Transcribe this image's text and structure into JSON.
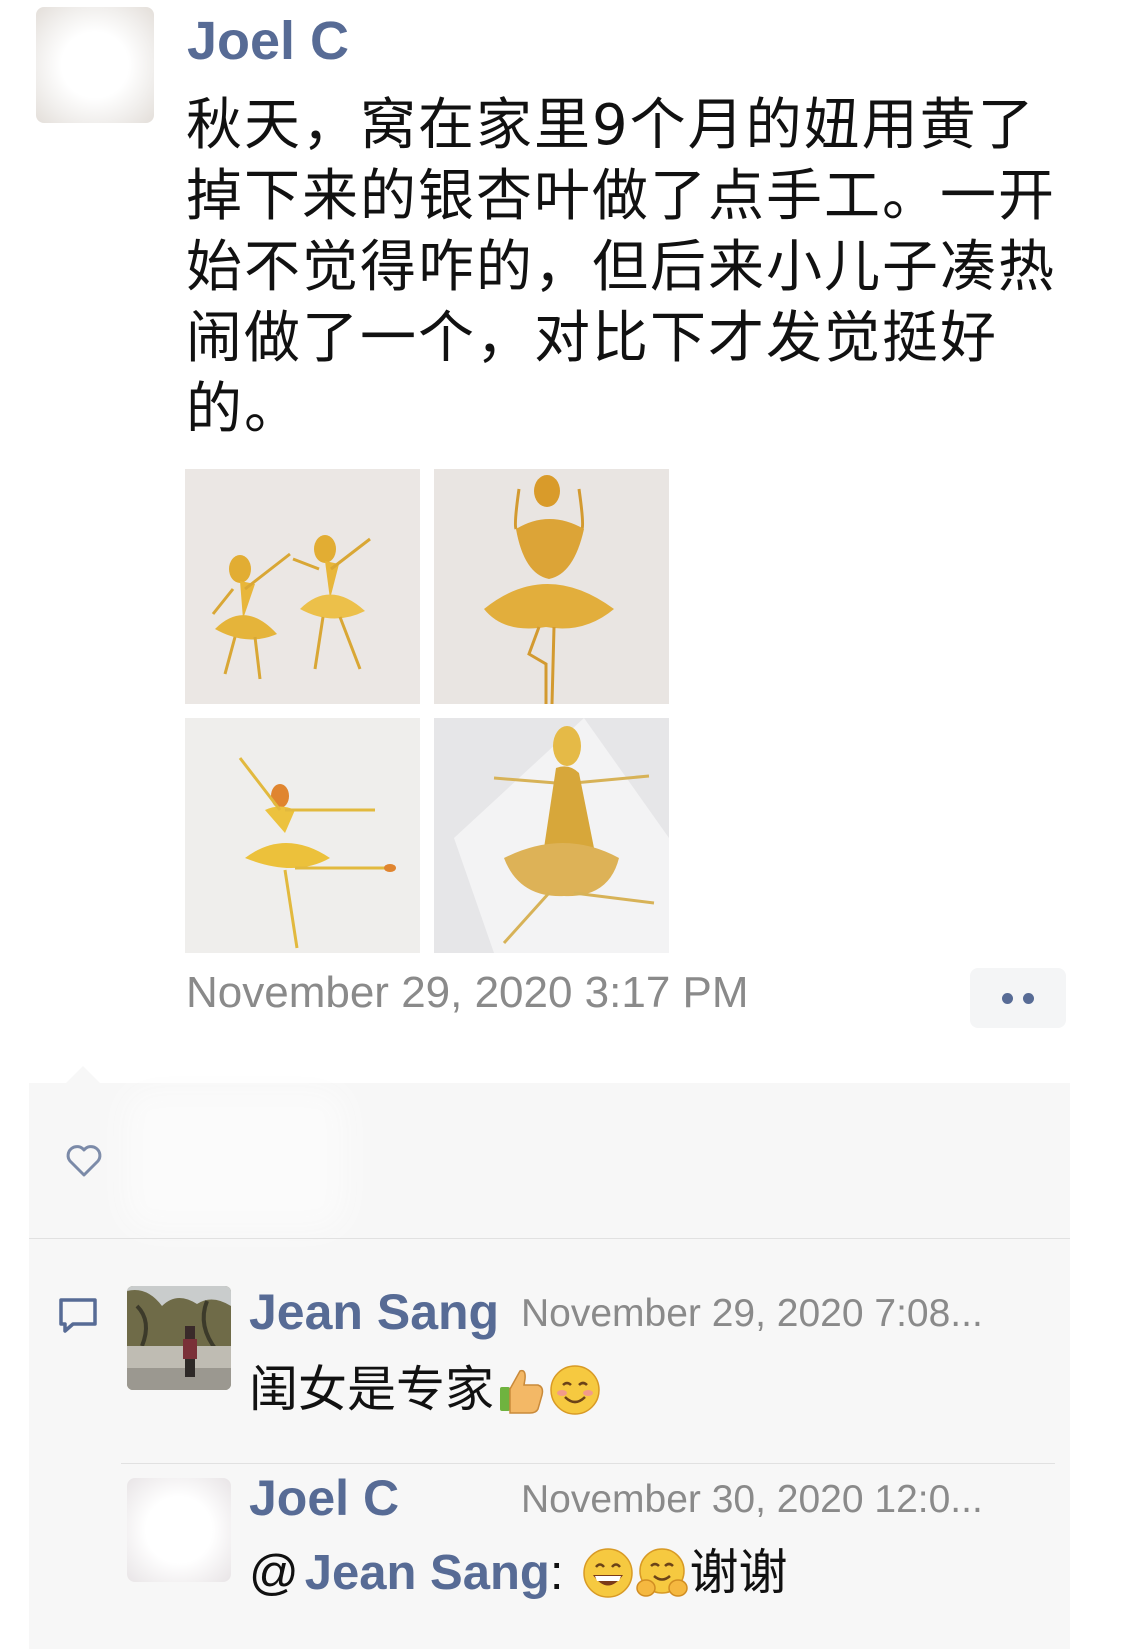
{
  "post": {
    "author": "Joel C",
    "text_lines": [
      "秋天，窝在家里9个月的妞用黄了",
      "掉下来的银杏叶做了点手工。一开",
      "始不觉得咋的，但后来小儿子凑热",
      "闹做了一个，对比下才发觉挺好",
      "的。"
    ],
    "photos": [
      {
        "icon": "ginkgo-leaf-dancers-photo"
      },
      {
        "icon": "ginkgo-leaf-ballerina-photo"
      },
      {
        "icon": "ginkgo-leaf-dancer-arabesque-photo"
      },
      {
        "icon": "ginkgo-leaf-dancer-large-skirt-photo"
      }
    ],
    "timestamp": "November 29, 2020 3:17 PM",
    "more_button_icon": "more-dots-icon"
  },
  "interactions": {
    "like_icon": "heart-icon",
    "comment_icon": "comment-icon"
  },
  "comments": [
    {
      "author": "Jean Sang",
      "time": "November 29, 2020 7:08...",
      "text": "闺女是专家",
      "emojis": [
        "thumbs-up-emoji",
        "smiling-face-emoji"
      ]
    },
    {
      "author": "Joel C",
      "time": "November 30, 2020 12:0...",
      "mention_prefix": "@",
      "mention": "Jean Sang",
      "mention_separator": ":",
      "emojis": [
        "grinning-face-emoji",
        "hugging-face-emoji"
      ],
      "text": "谢谢"
    }
  ],
  "colors": {
    "name_link": "#576b95",
    "body_text": "#111111",
    "timestamp": "#8a8a8a",
    "comment_panel": "#f7f7f7"
  }
}
